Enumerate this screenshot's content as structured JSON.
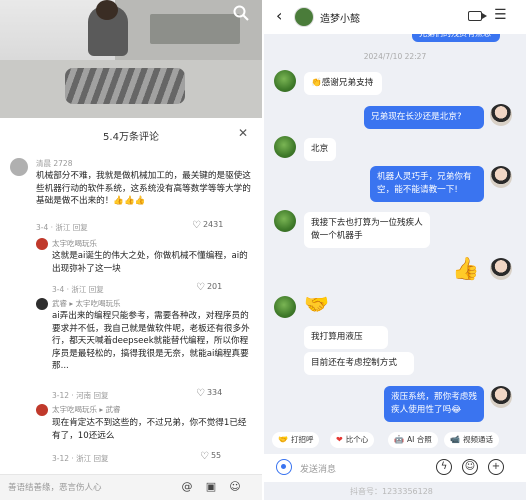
{
  "left": {
    "sheet_title": "5.4万条评论",
    "comments": [
      {
        "author": "清晨 2728",
        "text": "机械部分不难，我就是做机械加工的，最关键的是驱使这些机器行动的软件系统，这系统没有高等数学等等大学的基础是做不出来的！👍👍👍",
        "meta": "3-4 · 浙江   回复",
        "likes": "2431"
      },
      {
        "author": "太宇吃喝玩乐",
        "text": "这就是ai诞生的伟大之处，你做机械不懂编程，ai的出现弥补了这一块",
        "meta": "3-4 · 浙江   回复",
        "likes": "201"
      },
      {
        "author": "武睿 ▸ 太宇吃喝玩乐",
        "text": "ai弄出来的编程只能参考，需要各种改，对程序员的要求并不低，我自己就是做软件呢，老板还有很多外行，都天天喊着deepseek就能替代编程，所以你程序员是最轻松的，搞得我很是无奈，就能ai编程真要那...",
        "meta": "3-12 · 河南   回复",
        "likes": "334"
      },
      {
        "author": "太宇吃喝玩乐 ▸ 武睿",
        "text": "现在肯定达不到这些的，不过兄弟，你不觉得1已经有了，10还远么",
        "meta": "3-12 · 浙江   回复",
        "likes": "55"
      }
    ],
    "bottom_placeholder": "善语结善缘，恶言伤人心"
  },
  "right": {
    "contact_name": "造梦小懿",
    "top_partial_text": "兄弟们的残资有点悲啊",
    "timestamp": "2024/7/10 22:27",
    "messages": [
      {
        "side": "in",
        "text": "👏感谢兄弟支持"
      },
      {
        "side": "out",
        "text": "兄弟现在长沙还是北京?"
      },
      {
        "side": "in",
        "text": "北京"
      },
      {
        "side": "out",
        "text": "机器人灵巧手，兄弟你有空，能不能请教一下!"
      },
      {
        "side": "in",
        "text": "我接下去也打算为一位残疾人做一个机器手"
      },
      {
        "side": "out",
        "text": "👍"
      },
      {
        "side": "in",
        "text": "🤝"
      },
      {
        "side": "in",
        "text": "我打算用液压"
      },
      {
        "side": "in",
        "text": "目前还在考虑控制方式"
      },
      {
        "side": "out",
        "text": "液压系统，那你考虑残疾人使用性了吗😂"
      }
    ],
    "chips": [
      {
        "icon": "🤝",
        "label": "打招呼"
      },
      {
        "icon": "❤",
        "label": "比个心"
      },
      {
        "icon": "🤖",
        "label": "AI 合照"
      },
      {
        "icon": "📹",
        "label": "视频通话"
      }
    ],
    "input_placeholder": "发送消息",
    "watermark": "抖音号：1233356128"
  },
  "colors": {
    "bubble_out": "#3a74f0",
    "chat_bg": "#eef0f5"
  }
}
